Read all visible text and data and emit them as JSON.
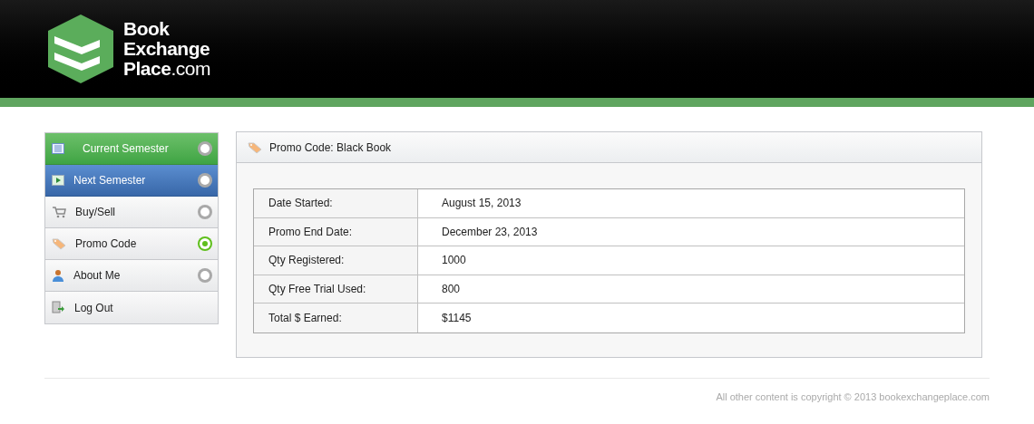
{
  "logo": {
    "lines": [
      "Book",
      "Exchange"
    ],
    "last_line": "**Place**.com"
  },
  "sidebar": {
    "items": [
      {
        "label": "Current Semester",
        "kind": "radio",
        "selected": false
      },
      {
        "label": "Next Semester",
        "kind": "radio",
        "selected": false
      },
      {
        "label": "Buy/Sell",
        "kind": "radio",
        "selected": false
      },
      {
        "label": "Promo Code",
        "kind": "radio",
        "selected": true
      },
      {
        "label": "About Me",
        "kind": "radio",
        "selected": false
      },
      {
        "label": "Log Out",
        "kind": "link"
      }
    ]
  },
  "panel": {
    "title": "Promo Code: Black Book",
    "rows": [
      {
        "label": "Date Started:",
        "value": "August 15, 2013"
      },
      {
        "label": "Promo End Date:",
        "value": "December 23, 2013"
      },
      {
        "label": "Qty Registered:",
        "value": "1000"
      },
      {
        "label": "Qty Free Trial Used:",
        "value": "800"
      },
      {
        "label": "Total $ Earned:",
        "value": "$1145"
      }
    ]
  },
  "footer": "All other content is copyright © 2013 bookexchangeplace.com"
}
